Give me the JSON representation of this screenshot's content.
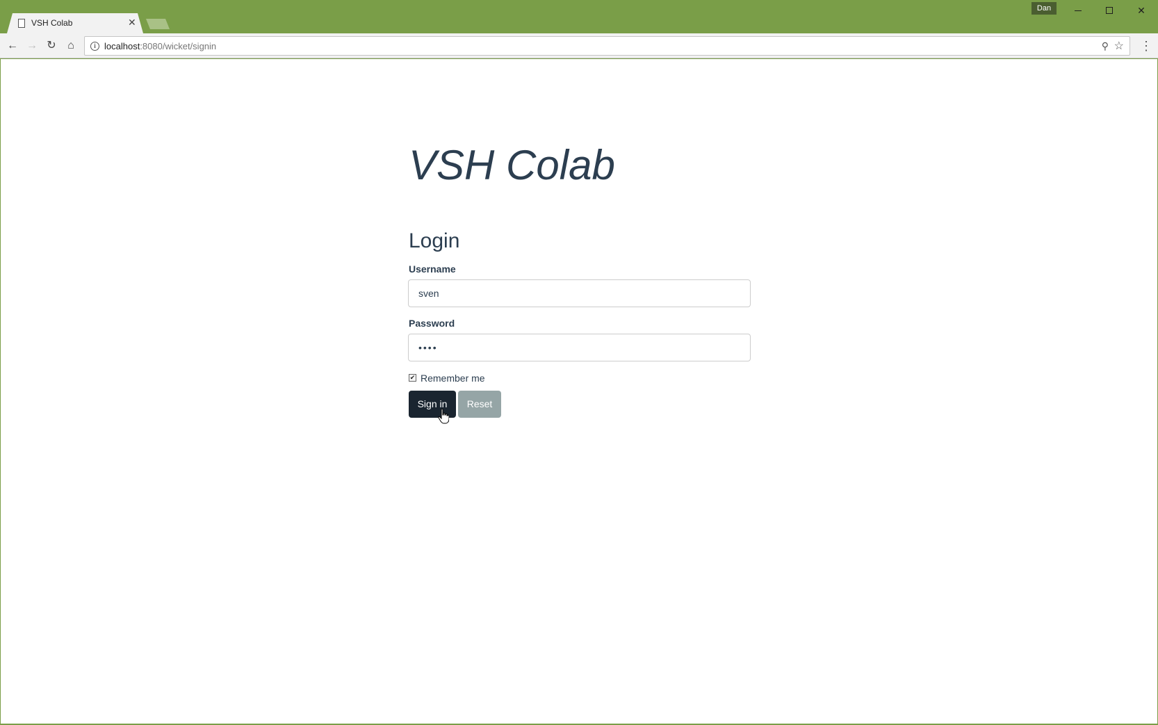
{
  "window": {
    "profile_name": "Dan",
    "controls": {
      "minimize_icon": "minimize-icon",
      "maximize_icon": "maximize-icon",
      "close_icon": "close-icon"
    }
  },
  "tabs": [
    {
      "title": "VSH Colab",
      "close_glyph": "✕",
      "active": true
    }
  ],
  "toolbar": {
    "url_host": "localhost",
    "url_path": ":8080/wicket/signin",
    "back_glyph": "←",
    "forward_glyph": "→",
    "reload_glyph": "↻",
    "home_glyph": "⌂",
    "zoom_glyph": "⚲",
    "star_glyph": "☆",
    "menu_glyph": "⋮",
    "info_glyph": "i"
  },
  "page": {
    "brand": "VSH Colab",
    "heading": "Login",
    "username_label": "Username",
    "username_value": "sven",
    "password_label": "Password",
    "password_value": "••••",
    "remember_label": "Remember me",
    "remember_checked": true,
    "remember_glyph": "✔",
    "signin_label": "Sign in",
    "reset_label": "Reset"
  },
  "colors": {
    "frame": "#7a9e48",
    "text_primary": "#2c3e50",
    "signin_bg": "#1a2530",
    "reset_bg": "#95a5a6"
  }
}
